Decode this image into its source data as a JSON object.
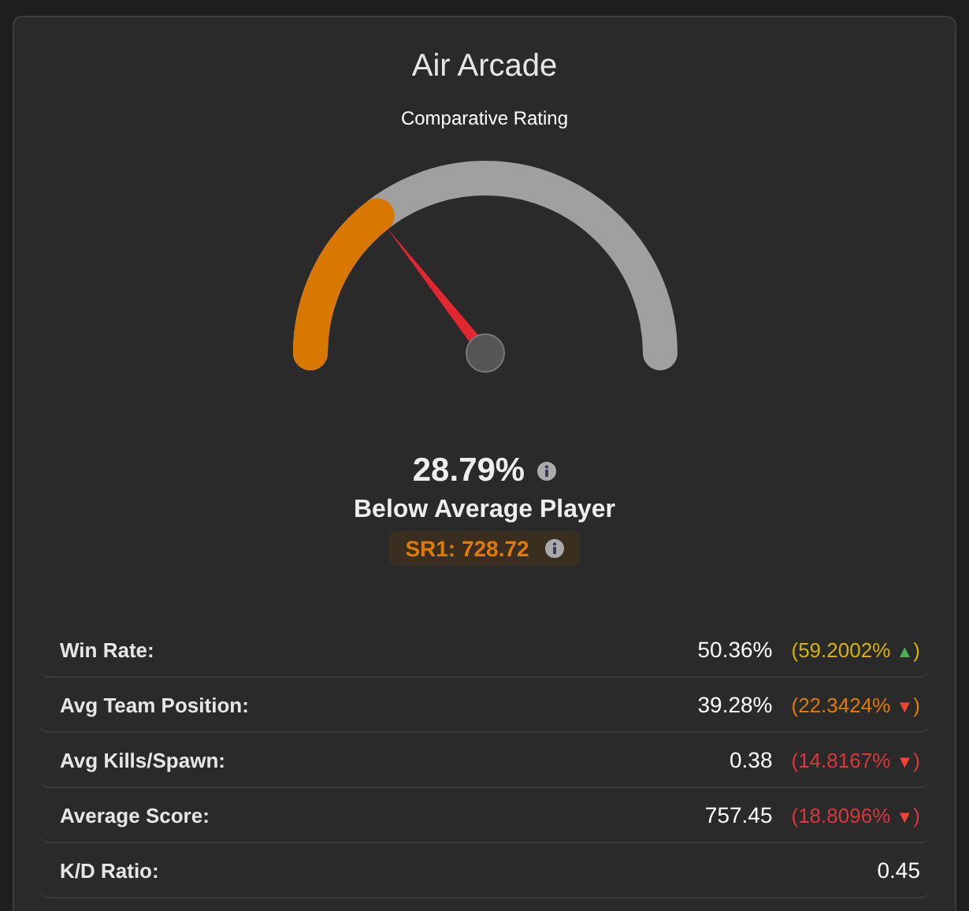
{
  "title": "Air Arcade",
  "subtitle": "Comparative Rating",
  "rating": {
    "percent": "28.79%",
    "label": "Below Average Player",
    "sr": "SR1: 728.72"
  },
  "stats": [
    {
      "label": "Win Rate:",
      "value": "50.36%",
      "change": {
        "open": "(",
        "value": "59.2002%",
        "arrow": "▲",
        "close": ")",
        "kind": "up",
        "color": "#d4b106"
      }
    },
    {
      "label": "Avg Team Position:",
      "value": "39.28%",
      "change": {
        "open": "(",
        "value": "22.3424%",
        "arrow": "▼",
        "close": ")",
        "kind": "down",
        "color": "#e07b00"
      }
    },
    {
      "label": "Avg Kills/Spawn:",
      "value": "0.38",
      "change": {
        "open": "(",
        "value": "14.8167%",
        "arrow": "▼",
        "close": ")",
        "kind": "down",
        "color": "#d9363e"
      }
    },
    {
      "label": "Average Score:",
      "value": "757.45",
      "change": {
        "open": "(",
        "value": "18.8096%",
        "arrow": "▼",
        "close": ")",
        "kind": "down",
        "color": "#d9363e"
      }
    },
    {
      "label": "K/D Ratio:",
      "value": "0.45"
    }
  ]
}
